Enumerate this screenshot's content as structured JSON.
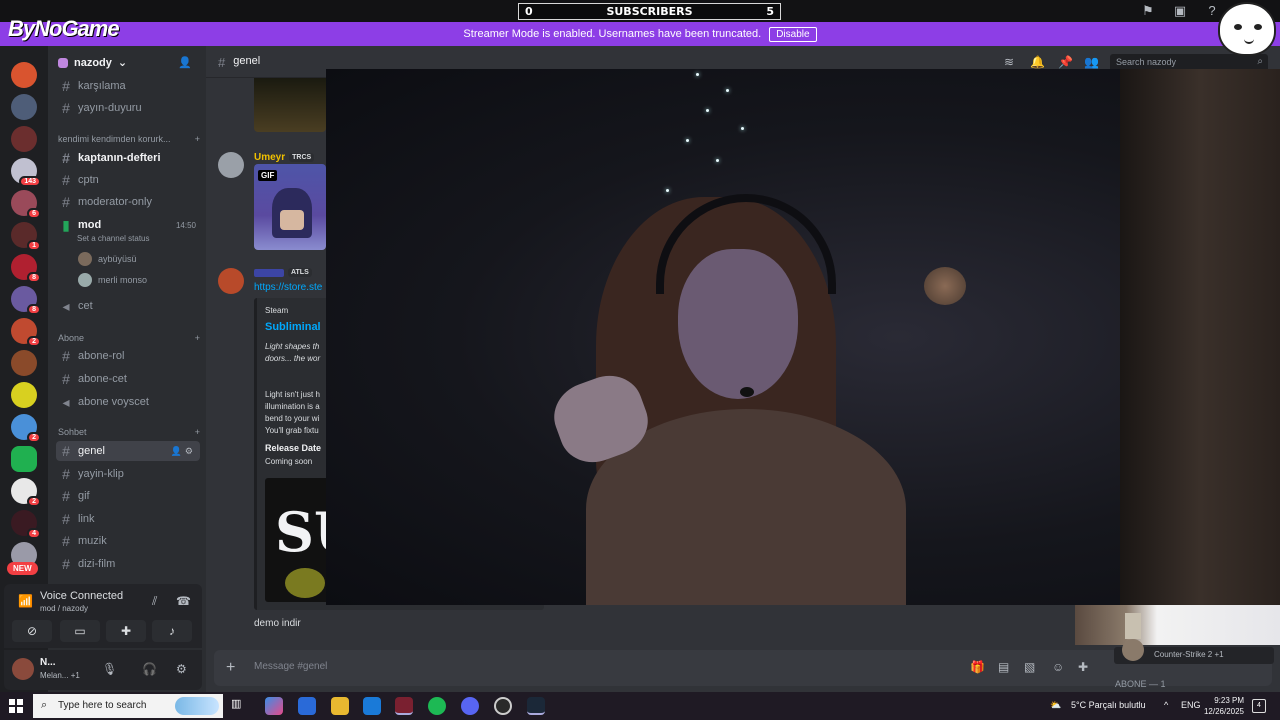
{
  "overlay": {
    "logo": "ByNoGame",
    "subscribers": {
      "label": "SUBSCRIBERS",
      "current": "0",
      "goal": "5"
    }
  },
  "banner": {
    "text": "Streamer Mode is enabled. Usernames have been truncated.",
    "disable_label": "Disable"
  },
  "server": {
    "name": "nazody",
    "badges": [
      "143",
      "6",
      "1",
      "8",
      "8",
      "2",
      "2",
      "2",
      "4"
    ],
    "new_label": "NEW"
  },
  "channels": {
    "top": [
      {
        "name": "karşılama"
      },
      {
        "name": "yayın-duyuru"
      }
    ],
    "category1": "kendimi kendimden korurk...",
    "cat1_items": [
      {
        "name": "kaptanın-defteri"
      },
      {
        "name": "cptn"
      },
      {
        "name": "moderator-only"
      }
    ],
    "voice": {
      "name": "mod",
      "status": "Set a channel status",
      "time": "14:50",
      "users": [
        "aybüyüsü",
        "merli monso"
      ]
    },
    "cet": "cet",
    "category2": "Abone",
    "cat2_items": [
      {
        "name": "abone-rol"
      },
      {
        "name": "abone-cet"
      },
      {
        "name": "abone voyscet"
      }
    ],
    "category3": "Sohbet",
    "cat3_items": [
      {
        "name": "genel"
      },
      {
        "name": "yayin-klip"
      },
      {
        "name": "gif"
      },
      {
        "name": "link"
      },
      {
        "name": "muzik"
      },
      {
        "name": "dizi-film"
      }
    ]
  },
  "voice_panel": {
    "title": "Voice Connected",
    "sub": "mod / nazody"
  },
  "user_panel": {
    "name": "N...",
    "status": "Melan...",
    "extra": "+1"
  },
  "main": {
    "channel": "genel",
    "search_placeholder": "Search nazody",
    "messages": {
      "m1_name": "Umeyr",
      "m1_tag": "TRCS",
      "gif_label": "GIF",
      "m2_tag": "ATLS",
      "link": "https://store.ste",
      "embed_provider": "Steam",
      "embed_title": "Subliminal",
      "embed_desc1": "Light shapes th doors... the wor",
      "embed_desc2": "Light isn't just h illumination is a bend to your wi You'll grab fixtu",
      "release_label": "Release Date",
      "release_value": "Coming soon",
      "image_text": "SU",
      "demo": "demo indir"
    },
    "composer_placeholder": "Message #genel"
  },
  "side_status": {
    "game": "Counter-Strike 2",
    "extra": "+1",
    "abone_count": "ABONE — 1"
  },
  "taskbar": {
    "search": "Type here to search",
    "weather": "5°C  Parçalı bulutlu",
    "lang": "ENG",
    "time": "9:23 PM",
    "date": "12/26/2025",
    "notif": "4"
  },
  "colors": {
    "banner": "#8d3ee6",
    "link": "#00a8fc",
    "badge": "#f23f43",
    "online": "#23a55a"
  }
}
